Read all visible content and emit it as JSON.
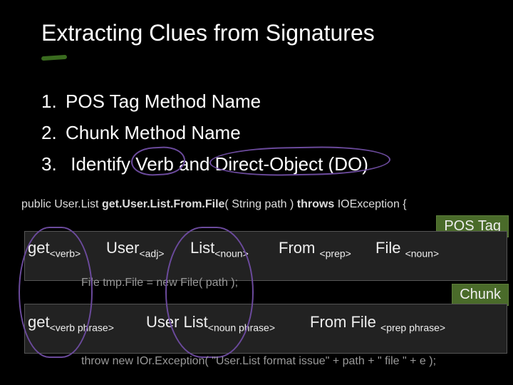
{
  "title": "Extracting Clues from Signatures",
  "list": [
    "POS Tag Method Name",
    "Chunk Method Name",
    "Identify Verb and Direct-Object (DO)"
  ],
  "verb_word": "Verb",
  "do_word": "Direct-Object (DO)",
  "signature": {
    "pre": "public User.List ",
    "method": "get.User.List.From.File",
    "args": "( String path ) ",
    "throws": "throws",
    "exc": " IOException  {"
  },
  "bg_code1": "File tmp.File  = new File( path );",
  "bg_code2": "throw new IOr.Exception( \"User.List format issue\" + path + \" file \" + e );",
  "labels": {
    "postag": "POS Tag",
    "chunk": "Chunk"
  },
  "tag": {
    "get": "get",
    "get_t": "<verb>",
    "user": "User",
    "user_t": "<adj>",
    "list": "List",
    "list_t": "<noun>",
    "from": "From",
    "from_t": "<prep>",
    "file": "File",
    "file_t": "<noun>"
  },
  "chunk": {
    "get": "get",
    "get_t": "<verb phrase>",
    "userlist": "User List",
    "userlist_t": "<noun phrase>",
    "fromfile": "From File",
    "fromfile_t": "<prep phrase>"
  }
}
